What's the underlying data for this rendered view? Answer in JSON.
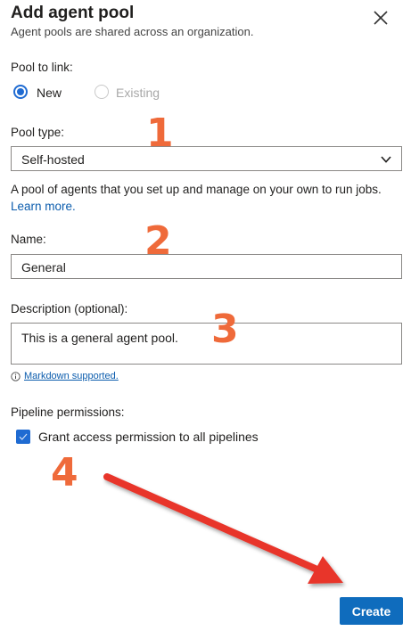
{
  "header": {
    "title": "Add agent pool",
    "subtitle": "Agent pools are shared across an organization."
  },
  "pool_to_link": {
    "label": "Pool to link:",
    "options": [
      "New",
      "Existing"
    ],
    "selected": "New"
  },
  "pool_type": {
    "label": "Pool type:",
    "value": "Self-hosted",
    "help_text": "A pool of agents that you set up and manage on your own to run jobs.",
    "help_link": "Learn more."
  },
  "name": {
    "label": "Name:",
    "value": "General"
  },
  "description": {
    "label": "Description (optional):",
    "value": "This is a general agent pool.",
    "markdown_link": "Markdown supported."
  },
  "pipeline_permissions": {
    "label": "Pipeline permissions:",
    "checkbox_label": "Grant access permission to all pipelines",
    "checked": true
  },
  "annotations": {
    "step_1": "1",
    "step_2": "2",
    "step_3": "3",
    "step_4": "4",
    "annotation_color": "#ef6a3a",
    "arrow_color": "#e8342a"
  },
  "footer": {
    "create_label": "Create"
  },
  "colors": {
    "accent": "#0f6cbd",
    "link": "#0b5cad"
  }
}
